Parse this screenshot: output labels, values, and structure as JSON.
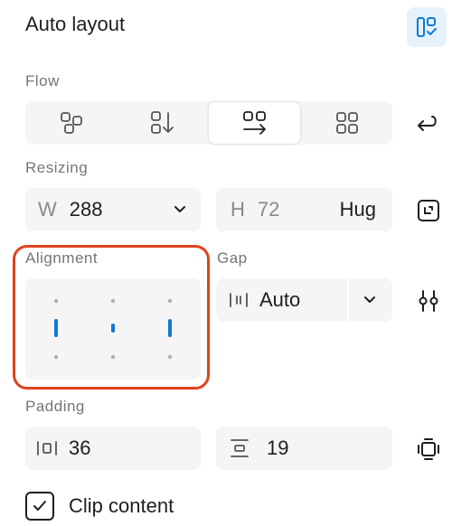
{
  "header": {
    "title": "Auto layout",
    "layout_icon": "auto-layout-panel-icon"
  },
  "flow": {
    "label": "Flow",
    "options": [
      "freeform",
      "vertical",
      "horizontal",
      "wrap"
    ],
    "selected": "horizontal"
  },
  "resizing": {
    "label": "Resizing",
    "width": {
      "prefix": "W",
      "value": "288"
    },
    "height": {
      "prefix": "H",
      "value": "72",
      "mode": "Hug"
    }
  },
  "alignment": {
    "label": "Alignment"
  },
  "gap": {
    "label": "Gap",
    "value": "Auto"
  },
  "padding": {
    "label": "Padding",
    "horizontal": "36",
    "vertical": "19"
  },
  "clip": {
    "label": "Clip content",
    "checked": true
  },
  "colors": {
    "accent": "#0d7ad6",
    "highlight": "#e0421d",
    "field_bg": "#f5f5f5"
  }
}
